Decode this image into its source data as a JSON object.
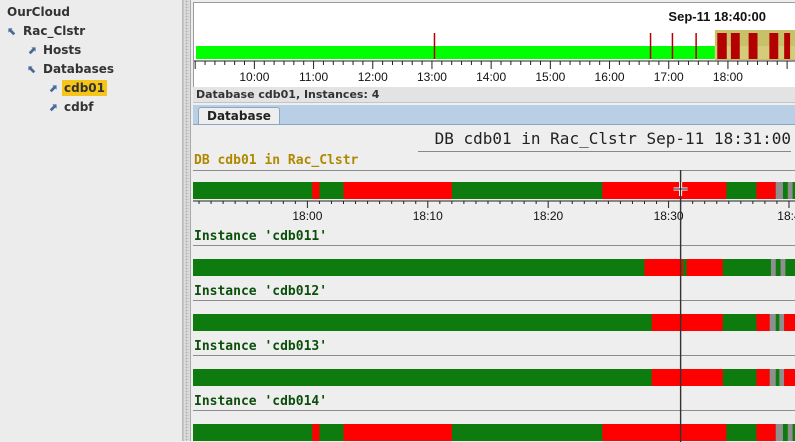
{
  "tree": {
    "root": "OurCloud",
    "cluster": "Rac_Clstr",
    "hosts": "Hosts",
    "databases": "Databases",
    "db_selected": "cdb01",
    "db_other": "cdbf"
  },
  "overview": {
    "clock": "Sep-11  18:40:00",
    "ticks": [
      "10:00",
      "11:00",
      "12:00",
      "13:00",
      "14:00",
      "15:00",
      "16:00",
      "17:00",
      "18:00"
    ],
    "tick_hours": [
      10,
      11,
      12,
      13,
      14,
      15,
      16,
      17,
      18
    ],
    "span_hours": [
      8.98,
      19.15
    ],
    "marks_hours": [
      13.03,
      16.68,
      17.05,
      17.45
    ],
    "selection_hours": [
      17.78,
      19.15
    ],
    "alert_blocks_hours": [
      [
        17.82,
        17.98
      ],
      [
        18.05,
        18.2
      ],
      [
        18.35,
        18.5
      ],
      [
        18.7,
        18.85
      ],
      [
        18.95,
        19.05
      ]
    ]
  },
  "status": "Database cdb01, Instances: 4",
  "tab": "Database",
  "detail": {
    "title": "DB cdb01 in Rac_Clstr Sep-11  18:31:00",
    "db_label": "DB cdb01 in Rac_Clstr",
    "ticks": [
      "18:00",
      "18:10",
      "18:20",
      "18:30",
      "18:4"
    ],
    "tick_minutes": [
      0,
      10,
      20,
      30,
      40
    ],
    "span_minutes": [
      -9.5,
      40.5
    ],
    "cursor_minute": 31.0,
    "colors": {
      "ok": "#0e7b0e",
      "alert": "#ff0000",
      "warn": "#8f8f8f",
      "ok_overview": "#00ff00",
      "alert_overview": "#b30000",
      "selection": "#c9c06a"
    },
    "rows": [
      {
        "key": "db",
        "label": "DB cdb01 in Rac_Clstr",
        "segments": [
          {
            "from": 0.4,
            "to": 1.0,
            "state": "alert"
          },
          {
            "from": 3.0,
            "to": 12.0,
            "state": "alert"
          },
          {
            "from": 24.5,
            "to": 34.8,
            "state": "alert"
          },
          {
            "from": 37.3,
            "to": 38.9,
            "state": "alert"
          },
          {
            "from": 38.9,
            "to": 39.5,
            "state": "warn"
          },
          {
            "from": 39.9,
            "to": 40.3,
            "state": "warn"
          }
        ]
      },
      {
        "key": "i1",
        "label": "Instance 'cdb011'",
        "segments": [
          {
            "from": 28.0,
            "to": 31.2,
            "state": "alert"
          },
          {
            "from": 31.5,
            "to": 34.5,
            "state": "alert"
          },
          {
            "from": 38.5,
            "to": 38.9,
            "state": "warn"
          },
          {
            "from": 39.3,
            "to": 39.7,
            "state": "warn"
          }
        ]
      },
      {
        "key": "i2",
        "label": "Instance 'cdb012'",
        "segments": [
          {
            "from": 28.6,
            "to": 34.5,
            "state": "alert"
          },
          {
            "from": 37.3,
            "to": 38.4,
            "state": "alert"
          },
          {
            "from": 38.4,
            "to": 38.9,
            "state": "warn"
          },
          {
            "from": 39.2,
            "to": 39.6,
            "state": "warn"
          },
          {
            "from": 39.6,
            "to": 40.5,
            "state": "alert"
          }
        ]
      },
      {
        "key": "i3",
        "label": "Instance 'cdb013'",
        "segments": [
          {
            "from": 28.6,
            "to": 34.5,
            "state": "alert"
          },
          {
            "from": 37.3,
            "to": 38.4,
            "state": "alert"
          },
          {
            "from": 38.4,
            "to": 38.9,
            "state": "warn"
          },
          {
            "from": 39.2,
            "to": 39.6,
            "state": "warn"
          },
          {
            "from": 39.6,
            "to": 40.5,
            "state": "alert"
          }
        ]
      },
      {
        "key": "i4",
        "label": "Instance 'cdb014'",
        "segments": [
          {
            "from": 0.4,
            "to": 1.0,
            "state": "alert"
          },
          {
            "from": 3.0,
            "to": 12.0,
            "state": "alert"
          },
          {
            "from": 24.5,
            "to": 34.8,
            "state": "alert"
          },
          {
            "from": 37.3,
            "to": 38.9,
            "state": "alert"
          },
          {
            "from": 38.9,
            "to": 39.5,
            "state": "warn"
          },
          {
            "from": 39.9,
            "to": 40.3,
            "state": "warn"
          }
        ]
      }
    ]
  }
}
